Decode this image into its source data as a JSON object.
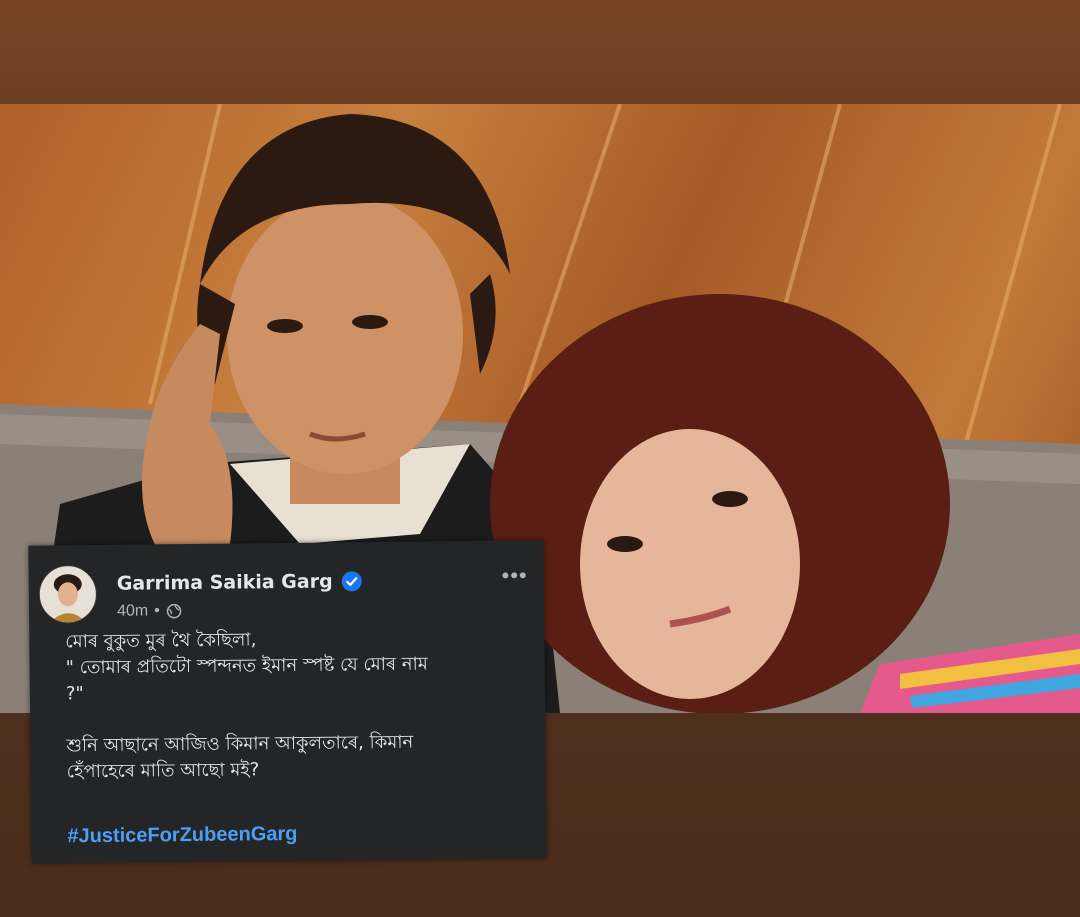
{
  "post": {
    "author": "Garrima Saikia Garg",
    "time": "40m",
    "separator": "•",
    "more_label": "•••",
    "body_lines": [
      "মোৰ বুকুত মুৰ থৈ কৈছিলা,",
      "\" তোমাৰ প্ৰতিটো স্পন্দনত ইমান স্পষ্ট যে মোৰ নাম",
      "?\""
    ],
    "body_lines_2": [
      "শুনি আছানে আজিও কিমান আকুলতাৰে, কিমান",
      "হেঁপাহেৰে মাতি আছো মই?"
    ],
    "hashtag": "#JusticeForZubeenGarg"
  },
  "icons": {
    "verified": "verified-badge-icon",
    "audience": "globe-icon",
    "more": "more-options-icon"
  },
  "colors": {
    "card_bg": "#242526",
    "hashtag": "#4b9ff5",
    "verified": "#1877f2",
    "secondary_text": "#b0b3b8",
    "frame_brown": "#6b3d22"
  }
}
